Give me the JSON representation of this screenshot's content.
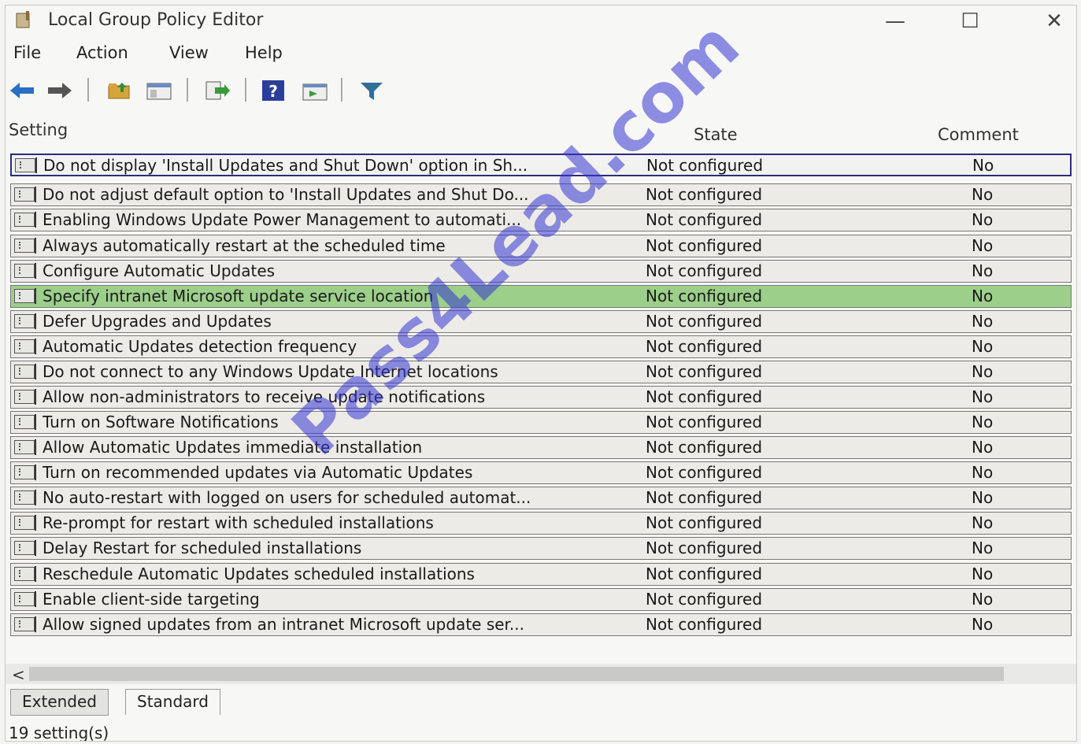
{
  "window": {
    "title": "Local Group Policy Editor"
  },
  "title_buttons": {
    "minimize": "—",
    "maximize": "☐",
    "close": "✕"
  },
  "menu": [
    "File",
    "Action",
    "View",
    "Help"
  ],
  "toolbar": [
    {
      "icon": "back-arrow-icon"
    },
    {
      "icon": "forward-arrow-icon"
    },
    {
      "icon": "up-folder-icon"
    },
    {
      "icon": "show-hide-tree-icon"
    },
    {
      "icon": "export-list-icon"
    },
    {
      "icon": "help-icon"
    },
    {
      "icon": "properties-icon"
    },
    {
      "icon": "filter-icon"
    }
  ],
  "columns": {
    "setting": "Setting",
    "state": "State",
    "comment": "Comment"
  },
  "rows": [
    {
      "name": "Do not display 'Install Updates and Shut Down' option in Sh...",
      "state": "Not configured",
      "comment": "No"
    },
    {
      "name": "Do not adjust default option to 'Install Updates and Shut Do...",
      "state": "Not configured",
      "comment": "No"
    },
    {
      "name": "Enabling Windows Update Power Management to automati...",
      "state": "Not configured",
      "comment": "No"
    },
    {
      "name": "Always automatically restart at the scheduled time",
      "state": "Not configured",
      "comment": "No"
    },
    {
      "name": "Configure Automatic Updates",
      "state": "Not configured",
      "comment": "No"
    },
    {
      "name": "Specify intranet Microsoft update service location",
      "state": "Not configured",
      "comment": "No"
    },
    {
      "name": "Defer Upgrades and Updates",
      "state": "Not configured",
      "comment": "No"
    },
    {
      "name": "Automatic Updates detection frequency",
      "state": "Not configured",
      "comment": "No"
    },
    {
      "name": "Do not connect to any Windows Update Internet locations",
      "state": "Not configured",
      "comment": "No"
    },
    {
      "name": "Allow non-administrators to receive update notifications",
      "state": "Not configured",
      "comment": "No"
    },
    {
      "name": "Turn on Software Notifications",
      "state": "Not configured",
      "comment": "No"
    },
    {
      "name": "Allow Automatic Updates immediate installation",
      "state": "Not configured",
      "comment": "No"
    },
    {
      "name": "Turn on recommended updates via Automatic Updates",
      "state": "Not configured",
      "comment": "No"
    },
    {
      "name": "No auto-restart with logged on users for scheduled automat...",
      "state": "Not configured",
      "comment": "No"
    },
    {
      "name": "Re-prompt for restart with scheduled installations",
      "state": "Not configured",
      "comment": "No"
    },
    {
      "name": "Delay Restart for scheduled installations",
      "state": "Not configured",
      "comment": "No"
    },
    {
      "name": "Reschedule Automatic Updates scheduled installations",
      "state": "Not configured",
      "comment": "No"
    },
    {
      "name": "Enable client-side targeting",
      "state": "Not configured",
      "comment": "No"
    },
    {
      "name": "Allow signed updates from an intranet Microsoft update ser...",
      "state": "Not configured",
      "comment": "No"
    }
  ],
  "scroll": {
    "left_arrow": "<"
  },
  "tabs": {
    "extended": "Extended",
    "standard": "Standard"
  },
  "status": {
    "text": "19 setting(s)"
  },
  "watermark": "Pass4Lead.com",
  "colors": {
    "selected_border": "#2c2c7a",
    "highlight_row": "#9ccf8a",
    "watermark": "#3434d2"
  }
}
